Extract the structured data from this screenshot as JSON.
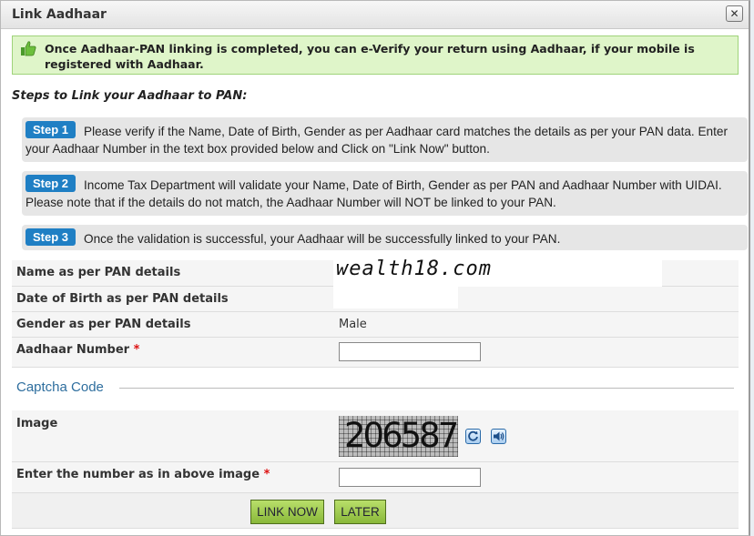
{
  "dialog": {
    "title": "Link Aadhaar",
    "close_label": "✕"
  },
  "notice": {
    "message": "Once Aadhaar-PAN linking is completed, you can e-Verify your return using Aadhaar, if your mobile is registered with Aadhaar."
  },
  "steps": {
    "heading": "Steps to Link your Aadhaar to PAN:",
    "items": [
      {
        "badge": "Step 1",
        "text": "Please verify if the Name, Date of Birth, Gender as per Aadhaar card matches the details as per your PAN data. Enter your Aadhaar Number in the text box provided below and Click on \"Link Now\" button."
      },
      {
        "badge": "Step 2",
        "text": "Income Tax Department will validate your Name, Date of Birth, Gender as per PAN and Aadhaar Number with UIDAI. Please note that if the details do not match, the Aadhaar Number will NOT be linked to your PAN."
      },
      {
        "badge": "Step 3",
        "text": "Once the validation is successful, your Aadhaar will be successfully linked to your PAN."
      }
    ]
  },
  "form": {
    "name_label": "Name as per PAN details",
    "name_value": "wealth18.com",
    "dob_label": "Date of Birth as per PAN details",
    "gender_label": "Gender as per PAN details",
    "gender_value": "Male",
    "aadhaar_label": "Aadhaar Number",
    "required_mark": "*",
    "aadhaar_value": ""
  },
  "captcha": {
    "section_title": "Captcha Code",
    "image_label": "Image",
    "image_text": "206587",
    "enter_label": "Enter the number as in above image",
    "enter_value": ""
  },
  "buttons": {
    "link_now": "LINK NOW",
    "later": "LATER"
  },
  "colors": {
    "step_badge": "#1f7fc4",
    "notice_bg": "#dff5c9",
    "button_green": "#9ccc4c",
    "required": "#dd1111"
  }
}
